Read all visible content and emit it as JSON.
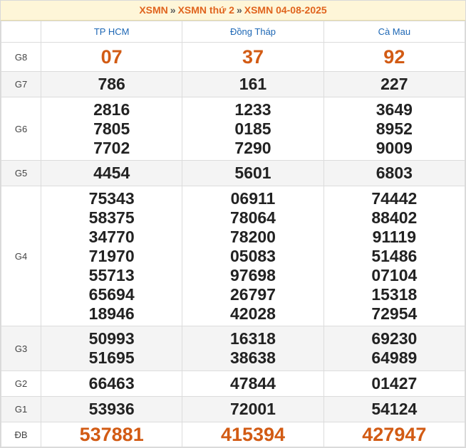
{
  "header": {
    "crumb1": "XSMN",
    "crumb2": "XSMN thứ 2",
    "crumb3": "XSMN 04-08-2025",
    "separator": "»"
  },
  "columns": [
    "TP HCM",
    "Đồng Tháp",
    "Cà Mau"
  ],
  "prizes": [
    {
      "label": "G8",
      "values": [
        [
          "07"
        ],
        [
          "37"
        ],
        [
          "92"
        ]
      ]
    },
    {
      "label": "G7",
      "values": [
        [
          "786"
        ],
        [
          "161"
        ],
        [
          "227"
        ]
      ]
    },
    {
      "label": "G6",
      "values": [
        [
          "2816",
          "7805",
          "7702"
        ],
        [
          "1233",
          "0185",
          "7290"
        ],
        [
          "3649",
          "8952",
          "9009"
        ]
      ]
    },
    {
      "label": "G5",
      "values": [
        [
          "4454"
        ],
        [
          "5601"
        ],
        [
          "6803"
        ]
      ]
    },
    {
      "label": "G4",
      "values": [
        [
          "75343",
          "58375",
          "34770",
          "71970",
          "55713",
          "65694",
          "18946"
        ],
        [
          "06911",
          "78064",
          "78200",
          "05083",
          "97698",
          "26797",
          "42028"
        ],
        [
          "74442",
          "88402",
          "91119",
          "51486",
          "07104",
          "15318",
          "72954"
        ]
      ]
    },
    {
      "label": "G3",
      "values": [
        [
          "50993",
          "51695"
        ],
        [
          "16318",
          "38638"
        ],
        [
          "69230",
          "64989"
        ]
      ]
    },
    {
      "label": "G2",
      "values": [
        [
          "66463"
        ],
        [
          "47844"
        ],
        [
          "01427"
        ]
      ]
    },
    {
      "label": "G1",
      "values": [
        [
          "53936"
        ],
        [
          "72001"
        ],
        [
          "54124"
        ]
      ]
    },
    {
      "label": "ĐB",
      "values": [
        [
          "537881"
        ],
        [
          "415394"
        ],
        [
          "427947"
        ]
      ]
    }
  ],
  "colors": {
    "accent": "#d25b14",
    "header_bg": "#fef6d8",
    "province": "#1d67b5"
  }
}
